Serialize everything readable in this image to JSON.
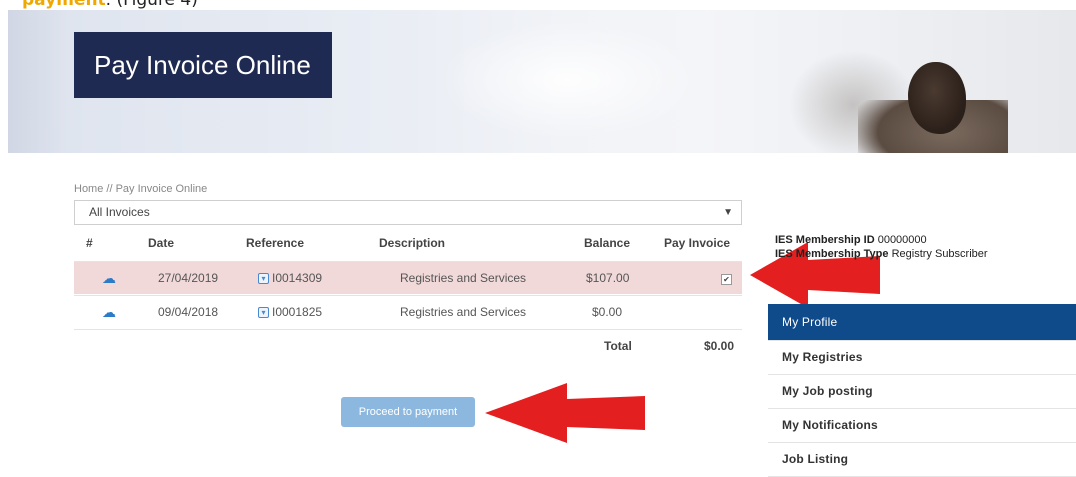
{
  "caption": {
    "highlight": "payment",
    "rest": ". (Figure 4)"
  },
  "hero": {
    "title": "Pay Invoice Online"
  },
  "breadcrumb": "Home // Pay Invoice Online",
  "filter": {
    "selected": "All Invoices"
  },
  "table": {
    "headers": {
      "num": "#",
      "date": "Date",
      "reference": "Reference",
      "description": "Description",
      "balance": "Balance",
      "pay": "Pay Invoice"
    },
    "rows": [
      {
        "date": "27/04/2019",
        "reference": "I0014309",
        "description": "Registries and Services",
        "balance": "$107.00",
        "checked": true
      },
      {
        "date": "09/04/2018",
        "reference": "I0001825",
        "description": "Registries and Services",
        "balance": "$0.00",
        "checked": false
      }
    ],
    "total_label": "Total",
    "total_value": "$0.00"
  },
  "actions": {
    "proceed": "Proceed to payment"
  },
  "member": {
    "id_label": "IES Membership ID",
    "id_value": "00000000",
    "type_prefix": "IES",
    "type_label": "Membership Type",
    "type_value": "Registry Subscriber"
  },
  "sidebar": {
    "items": [
      {
        "label": "My Profile",
        "active": true
      },
      {
        "label": "My Registries"
      },
      {
        "label": "My Job posting"
      },
      {
        "label": "My Notifications"
      },
      {
        "label": "Job Listing"
      }
    ]
  },
  "colors": {
    "arrow": "#e41f1f",
    "title_bg": "#1f2a52",
    "sidebar_active": "#0f4a8a",
    "row_selected": "#f2d9d9"
  }
}
